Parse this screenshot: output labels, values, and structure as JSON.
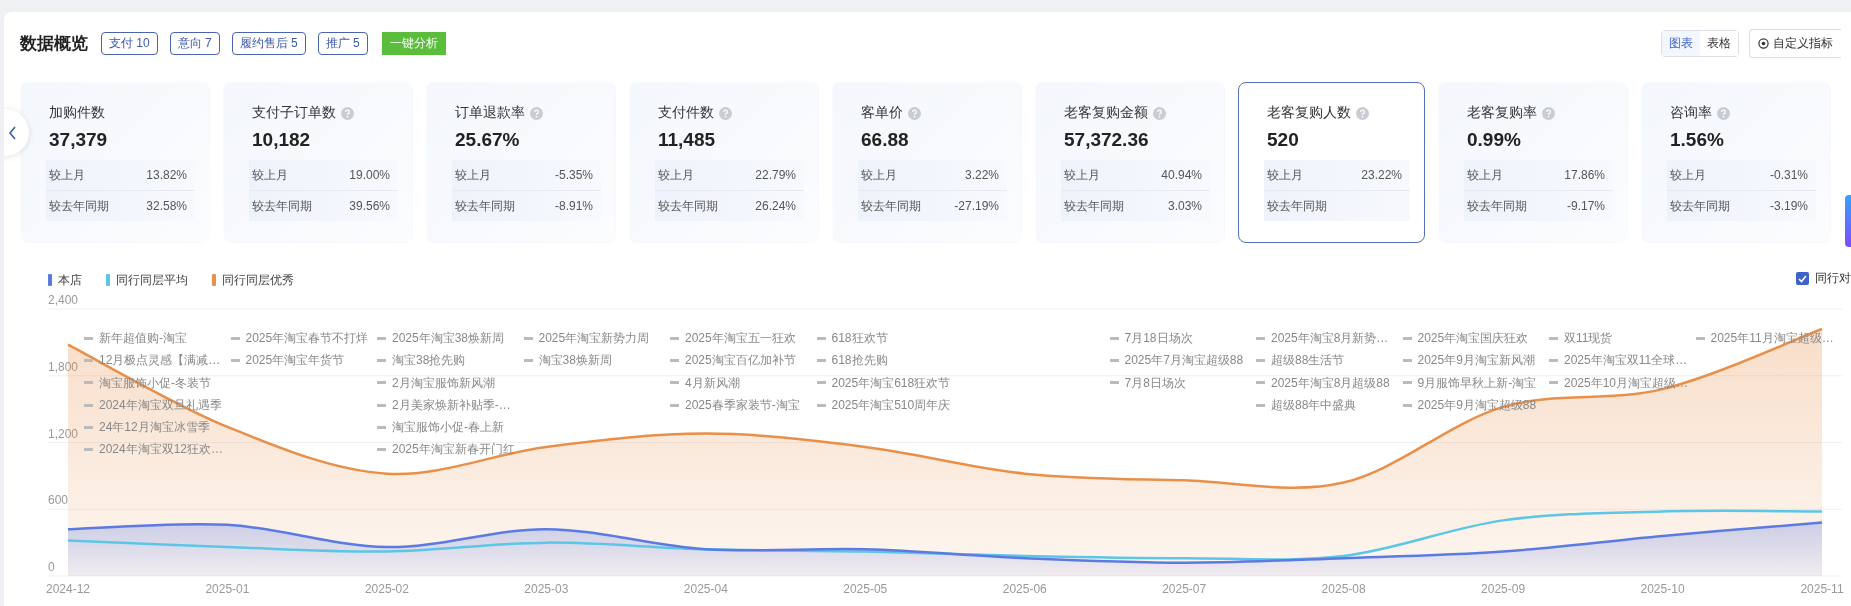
{
  "header": {
    "title": "数据概览",
    "tags": [
      {
        "label": "支付 10"
      },
      {
        "label": "意向 7"
      },
      {
        "label": "履约售后 5"
      },
      {
        "label": "推广 5"
      }
    ],
    "analyze_button": "一键分析",
    "view_tabs": [
      {
        "label": "图表",
        "selected": true
      },
      {
        "label": "表格",
        "selected": false
      }
    ],
    "custom_button": "自定义指标"
  },
  "metrics": [
    {
      "title": "加购件数",
      "help": false,
      "value": "37,379",
      "selected": false,
      "rows": [
        {
          "label": "较上月",
          "value": "13.82%"
        },
        {
          "label": "较去年同期",
          "value": "32.58%"
        }
      ]
    },
    {
      "title": "支付子订单数",
      "help": true,
      "value": "10,182",
      "selected": false,
      "rows": [
        {
          "label": "较上月",
          "value": "19.00%"
        },
        {
          "label": "较去年同期",
          "value": "39.56%"
        }
      ]
    },
    {
      "title": "订单退款率",
      "help": true,
      "value": "25.67%",
      "selected": false,
      "rows": [
        {
          "label": "较上月",
          "value": "-5.35%"
        },
        {
          "label": "较去年同期",
          "value": "-8.91%"
        }
      ]
    },
    {
      "title": "支付件数",
      "help": true,
      "value": "11,485",
      "selected": false,
      "rows": [
        {
          "label": "较上月",
          "value": "22.79%"
        },
        {
          "label": "较去年同期",
          "value": "26.24%"
        }
      ]
    },
    {
      "title": "客单价",
      "help": true,
      "value": "66.88",
      "selected": false,
      "rows": [
        {
          "label": "较上月",
          "value": "3.22%"
        },
        {
          "label": "较去年同期",
          "value": "-27.19%"
        }
      ]
    },
    {
      "title": "老客复购金额",
      "help": true,
      "value": "57,372.36",
      "selected": false,
      "rows": [
        {
          "label": "较上月",
          "value": "40.94%"
        },
        {
          "label": "较去年同期",
          "value": "3.03%"
        }
      ]
    },
    {
      "title": "老客复购人数",
      "help": true,
      "value": "520",
      "selected": true,
      "rows": [
        {
          "label": "较上月",
          "value": "23.22%"
        },
        {
          "label": "较去年同期"
        }
      ]
    },
    {
      "title": "老客复购率",
      "help": true,
      "value": "0.99%",
      "selected": false,
      "rows": [
        {
          "label": "较上月",
          "value": "17.86%"
        },
        {
          "label": "较去年同期",
          "value": "-9.17%"
        }
      ]
    },
    {
      "title": "咨询率",
      "help": true,
      "value": "1.56%",
      "selected": false,
      "rows": [
        {
          "label": "较上月",
          "value": "-0.31%"
        },
        {
          "label": "较去年同期",
          "value": "-3.19%"
        }
      ]
    }
  ],
  "chart": {
    "compare_checkbox": {
      "label": "同行对",
      "checked": true
    },
    "event_columns_before": [
      [
        "新年超值购-淘宝",
        "12月极点灵感【满减…",
        "淘宝服饰小促-冬装节",
        "2024年淘宝双旦礼遇季",
        "24年12月淘宝冰雪季",
        "2024年淘宝双12狂欢…"
      ],
      [
        "2025年淘宝春节不打烊",
        "2025年淘宝年货节"
      ],
      [
        "2025年淘宝38焕新周",
        "淘宝38抢先购",
        "2月淘宝服饰新风潮",
        "2月美家焕新补贴季-…",
        "淘宝服饰小促-春上新",
        "2025年淘宝新春开门红"
      ],
      [
        "2025年淘宝新势力周",
        "淘宝38焕新周"
      ],
      [
        "2025年淘宝五一狂欢",
        "2025淘宝百亿加补节",
        "4月新风潮",
        "2025春季家装节-淘宝"
      ],
      [
        "618狂欢节",
        "618抢先购",
        "2025年淘宝618狂欢节",
        "2025年淘宝510周年庆"
      ]
    ],
    "event_columns_after": [
      [
        "7月18日场次",
        "2025年7月淘宝超级88",
        "7月8日场次"
      ],
      [
        "2025年淘宝8月新势…",
        "超级88生活节",
        "2025年淘宝8月超级88",
        "超级88年中盛典"
      ],
      [
        "2025年淘宝国庆狂欢",
        "2025年9月淘宝新风潮",
        "9月服饰早秋上新-淘宝",
        "2025年9月淘宝超级88"
      ],
      [
        "双11现货",
        "2025年淘宝双11全球…",
        "2025年10月淘宝超级…"
      ],
      [
        "2025年11月淘宝超级…"
      ]
    ],
    "chart_data": {
      "type": "area",
      "categories": [
        "2024-12",
        "2025-01",
        "2025-02",
        "2025-03",
        "2025-04",
        "2025-05",
        "2025-06",
        "2025-07",
        "2025-08",
        "2025-09",
        "2025-10",
        "2025-11"
      ],
      "series": [
        {
          "name": "本店",
          "color": "#5b7be3",
          "values": [
            420,
            460,
            260,
            420,
            240,
            240,
            160,
            120,
            160,
            220,
            360,
            480
          ]
        },
        {
          "name": "同行同层平均",
          "type": "line",
          "color": "#5cc6e6",
          "values": [
            320,
            260,
            220,
            300,
            240,
            220,
            180,
            160,
            180,
            500,
            580,
            580
          ]
        },
        {
          "name": "同行同层优秀",
          "color": "#e8904a",
          "values": [
            2080,
            1340,
            920,
            1160,
            1280,
            1160,
            920,
            860,
            840,
            1520,
            1680,
            2220
          ]
        }
      ],
      "grid": true,
      "ylim": [
        0,
        2400
      ],
      "yticks": [
        {
          "value": 0,
          "label": "0"
        },
        {
          "value": 600,
          "label": "600"
        },
        {
          "value": 1200,
          "label": "1,200"
        },
        {
          "value": 1800,
          "label": "1,800"
        },
        {
          "value": 2400,
          "label": "2,400"
        }
      ]
    }
  }
}
